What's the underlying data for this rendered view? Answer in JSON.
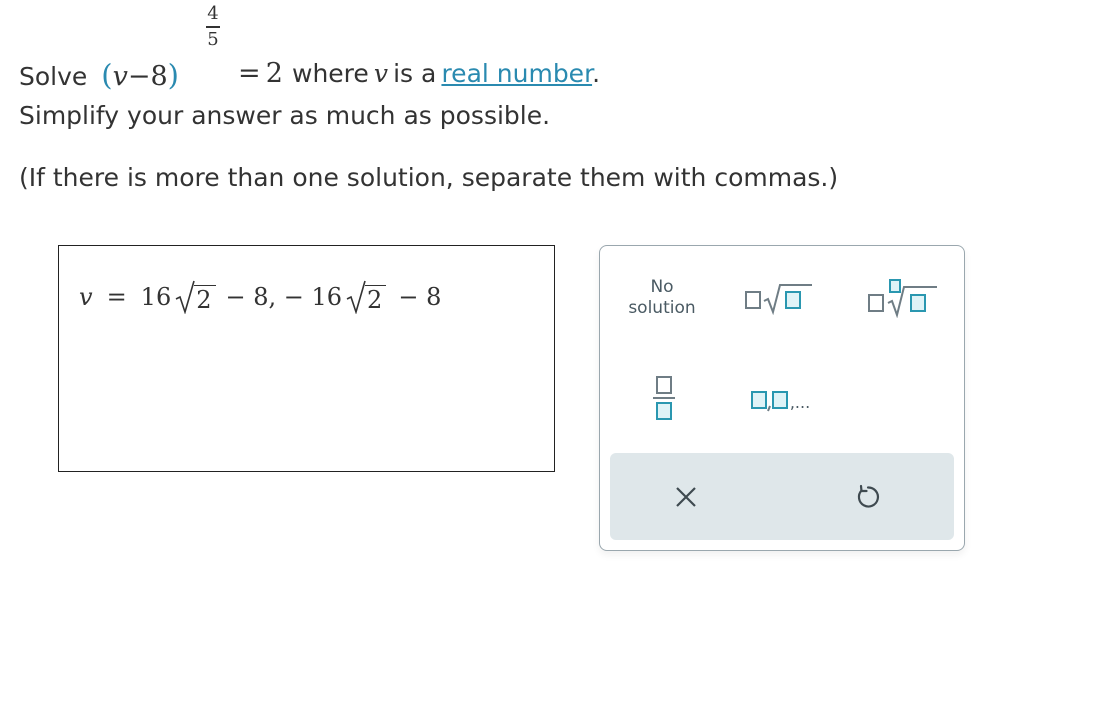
{
  "problem": {
    "solve_word": "Solve",
    "open_paren": "(",
    "variable": "v",
    "minus": "−",
    "constant": "8",
    "close_paren": ")",
    "exp_numerator": "4",
    "exp_denominator": "5",
    "equals": "=",
    "rhs": "2",
    "where_text": "where",
    "is_a_text": "is a",
    "link_text": "real number",
    "period": ".",
    "line2": "Simplify your answer as much as possible.",
    "line3": "(If there is more than one solution, separate them with commas.)"
  },
  "answer": {
    "variable": "v",
    "equals": "=",
    "coef1": "16",
    "radicand1": "2",
    "tail1": "− 8, − 16",
    "radicand2": "2",
    "tail2": "− 8"
  },
  "toolbox": {
    "no_solution_line1": "No",
    "no_solution_line2": "solution",
    "sqrt_icon": "square-root-template-icon",
    "nth_root_icon": "nth-root-template-icon",
    "fraction_icon": "fraction-template-icon",
    "list_icon": "comma-list-template-icon",
    "list_ellipsis": ",...",
    "clear_icon": "x-icon",
    "undo_icon": "undo-icon"
  },
  "colors": {
    "accent": "#2a8ab0",
    "toolbox_border": "#9aa7ae",
    "footer_bg": "#dfe7ea"
  }
}
